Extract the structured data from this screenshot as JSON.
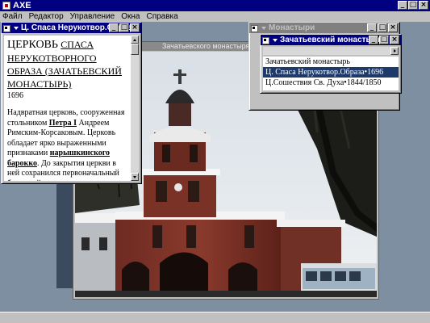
{
  "app": {
    "title": "AXE",
    "menu": [
      "Файл",
      "Редактор",
      "Управление",
      "Окна",
      "Справка"
    ]
  },
  "photo_window": {
    "title": "Зачатьевского монастыря с севера"
  },
  "text_window": {
    "title": "Ц. Спаса Нерукотвор.Образа",
    "heading_word": "ЦЕРКОВЬ",
    "heading_link": "СПАСА НЕРУКОТВОРНОГО ОБРАЗА (ЗАЧАТЬЕВСКИЙ МОНАСТЫРЬ)",
    "year": "1696",
    "para_1": "Надвратная церковь, сооруженная стольником ",
    "link_1": "Петра I",
    "para_2": " Андреем Римским-Корсаковым. Церковь обладает ярко выраженными признаками ",
    "link_2": "нарышкинского барокко",
    "para_3": ". До закрытия церкви в ней сохранился первоначальный барочный иконостас, как и некоторые образа XVII века. Храм числился приходским, то есть в нем венчали и крестили, чего не"
  },
  "monasteries_window": {
    "title": "Монастыри"
  },
  "zachatevsky_window": {
    "title": "Зачатьевский монастырь",
    "items": [
      "Зачатьевский монастырь",
      "Ц. Спаса Нерукотвор.Образа•1696",
      "Ц.Сошествия Св. Духа•1844/1850"
    ],
    "selected_index": 1
  },
  "icons": {
    "minimize": "minimize-icon",
    "maximize": "maximize-icon",
    "close": "close-icon"
  }
}
